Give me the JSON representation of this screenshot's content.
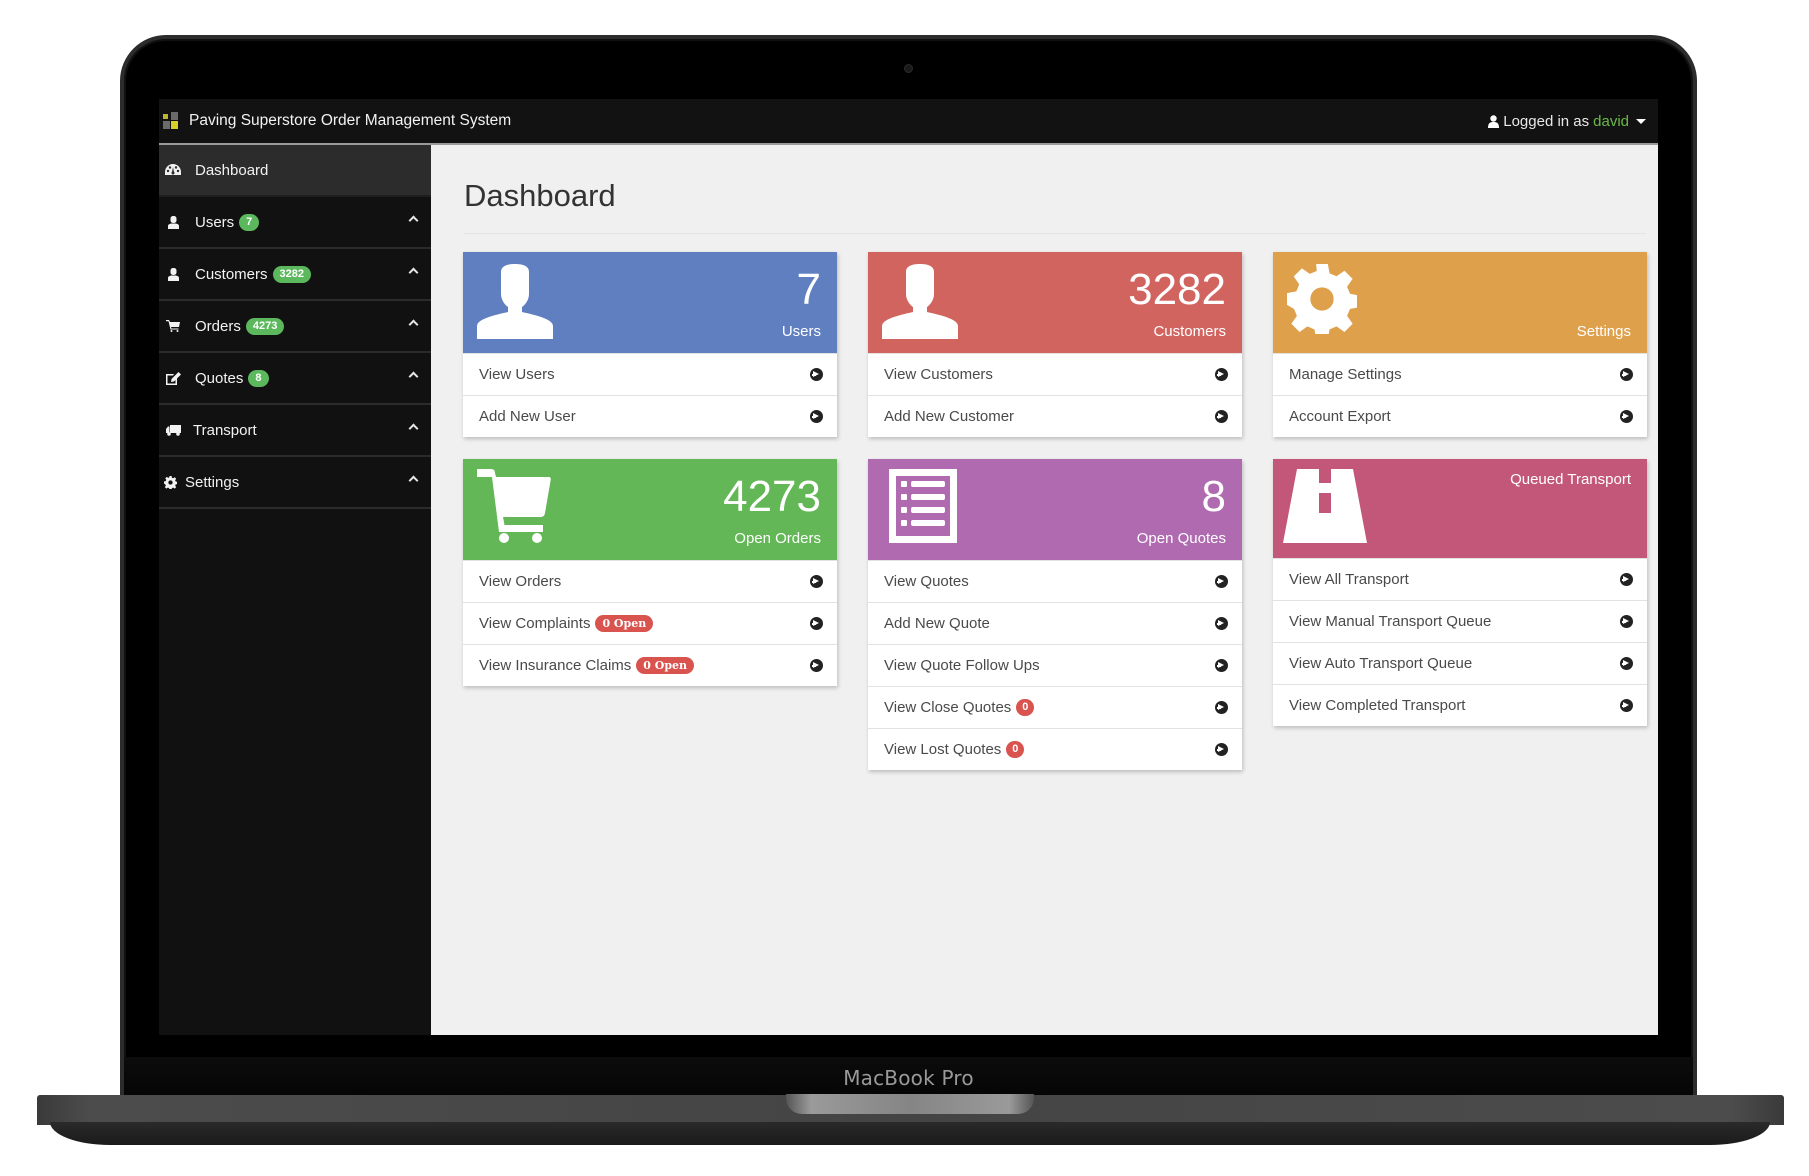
{
  "device": {
    "label": "MacBook Pro"
  },
  "topbar": {
    "app_title": "Paving Superstore Order Management System",
    "logged_in_prefix": "Logged in as",
    "username": "david"
  },
  "sidebar": {
    "items": [
      {
        "label": "Dashboard",
        "icon": "dashboard-icon",
        "active": true
      },
      {
        "label": "Users",
        "badge": "7",
        "icon": "user-icon"
      },
      {
        "label": "Customers",
        "badge": "3282",
        "icon": "user-icon"
      },
      {
        "label": "Orders",
        "badge": "4273",
        "icon": "cart-icon"
      },
      {
        "label": "Quotes",
        "badge": "8",
        "icon": "edit-icon"
      },
      {
        "label": "Transport",
        "icon": "truck-icon"
      },
      {
        "label": "Settings",
        "icon": "gear-icon"
      }
    ]
  },
  "main": {
    "title": "Dashboard",
    "cards": [
      {
        "id": "users",
        "color": "#5f7fc1",
        "icon": "user-icon",
        "count": "7",
        "label": "Users",
        "links": [
          {
            "label": "View Users"
          },
          {
            "label": "Add New User"
          }
        ]
      },
      {
        "id": "customers",
        "color": "#d26460",
        "icon": "user-icon",
        "count": "3282",
        "label": "Customers",
        "links": [
          {
            "label": "View Customers"
          },
          {
            "label": "Add New Customer"
          }
        ]
      },
      {
        "id": "settings",
        "color": "#dfa04c",
        "icon": "gear-icon",
        "label": "Settings",
        "links": [
          {
            "label": "Manage Settings"
          },
          {
            "label": "Account Export"
          }
        ]
      },
      {
        "id": "orders",
        "color": "#63b756",
        "icon": "cart-icon",
        "count": "4273",
        "label": "Open Orders",
        "links": [
          {
            "label": "View Orders"
          },
          {
            "label": "View Complaints",
            "badge": "0 Open"
          },
          {
            "label": "View Insurance Claims",
            "badge": "0 Open"
          }
        ]
      },
      {
        "id": "quotes",
        "color": "#b06ab0",
        "icon": "list-icon",
        "count": "8",
        "label": "Open Quotes",
        "links": [
          {
            "label": "View Quotes"
          },
          {
            "label": "Add New Quote"
          },
          {
            "label": "View Quote Follow Ups"
          },
          {
            "label": "View Close Quotes",
            "badge": "0"
          },
          {
            "label": "View Lost Quotes",
            "badge": "0"
          }
        ]
      },
      {
        "id": "transport",
        "color": "#c3577a",
        "icon": "road-icon",
        "label": "Queued Transport",
        "links": [
          {
            "label": "View All Transport"
          },
          {
            "label": "View Manual Transport Queue"
          },
          {
            "label": "View Auto Transport Queue"
          },
          {
            "label": "View Completed Transport"
          }
        ]
      }
    ]
  }
}
